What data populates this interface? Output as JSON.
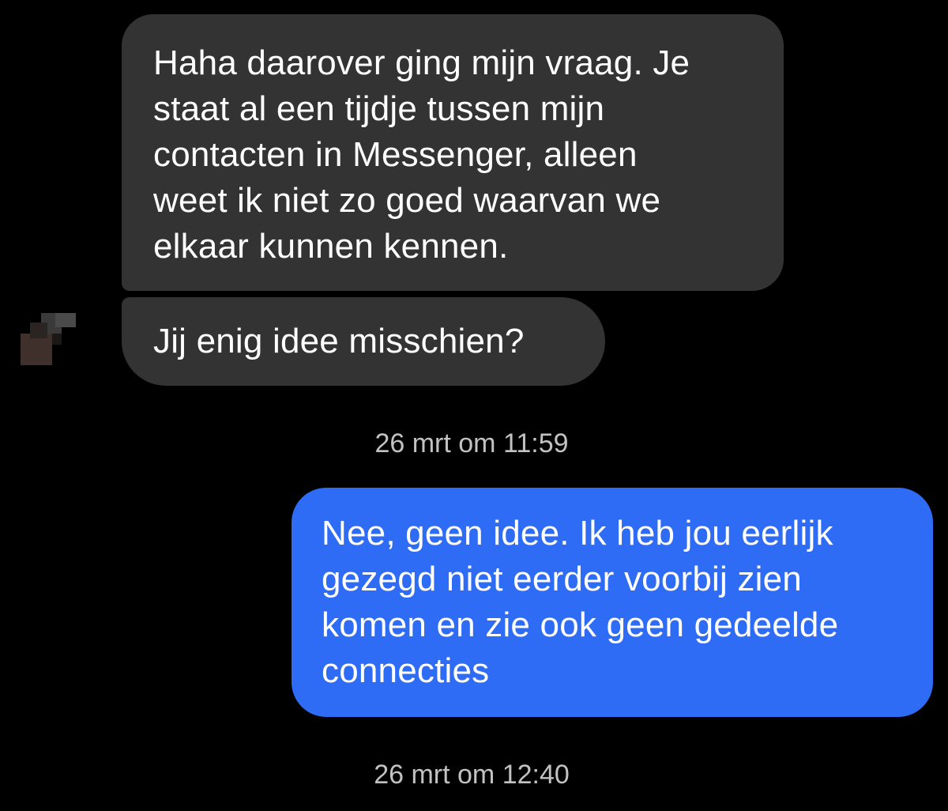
{
  "conversation": {
    "messages": [
      {
        "direction": "incoming",
        "lines": [
          "Haha daarover ging mijn vraag. Je",
          "staat al een tijdje tussen mijn",
          "contacten in Messenger, alleen",
          "weet ik niet zo goed waarvan we",
          "elkaar kunnen kennen."
        ]
      },
      {
        "direction": "incoming",
        "lines": [
          "Jij enig idee misschien?"
        ]
      },
      {
        "direction": "outgoing",
        "lines": [
          "Nee, geen idee. Ik heb jou eerlijk",
          "gezegd niet eerder voorbij zien",
          "komen en zie ook geen gedeelde",
          "connecties"
        ]
      }
    ],
    "timestamps": [
      "26 mrt om 11:59",
      "26 mrt om 12:40"
    ]
  },
  "sender_avatar": {
    "icon": "censored-avatar-icon"
  },
  "colors": {
    "background": "#000000",
    "incoming_bubble": "#333333",
    "outgoing_bubble": "#2f6cf5",
    "message_text": "#ffffff",
    "timestamp_text": "#c2c2c2"
  }
}
